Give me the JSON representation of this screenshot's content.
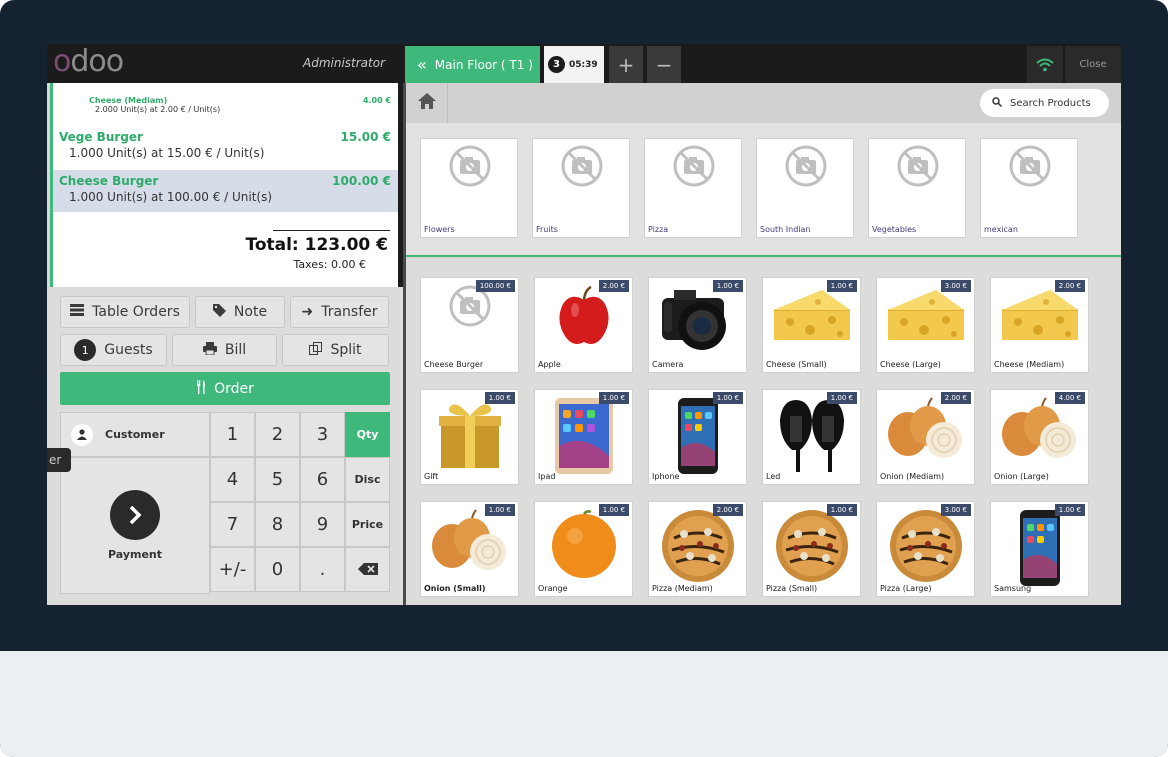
{
  "topbar": {
    "logo_left": "o",
    "logo_right": "doo",
    "user": "Administrator",
    "floor_tab": "Main Floor ( T1 )",
    "order_number": "3",
    "order_time": "05:39",
    "add_label": "+",
    "remove_label": "−",
    "close_label": "Close"
  },
  "order": {
    "lines": [
      {
        "name": "Cheese (Mediam)",
        "price": "4.00 €",
        "info": "2.000 Unit(s) at 2.00 € / Unit(s)"
      },
      {
        "name": "Vege Burger",
        "price": "15.00 €",
        "info": "1.000 Unit(s) at 15.00 € / Unit(s)"
      },
      {
        "name": "Cheese Burger",
        "price": "100.00 €",
        "info": "1.000 Unit(s) at 100.00 € / Unit(s)"
      }
    ],
    "total": "Total: 123.00 €",
    "taxes": "Taxes: 0.00 €"
  },
  "actions": {
    "table_orders": "Table Orders",
    "note": "Note",
    "transfer": "Transfer",
    "guests_count": "1",
    "guests": "Guests",
    "bill": "Bill",
    "split": "Split",
    "order": "Order"
  },
  "keypad": {
    "customer": "Customer",
    "payment": "Payment",
    "keys": [
      "1",
      "2",
      "3",
      "4",
      "5",
      "6",
      "7",
      "8",
      "9",
      "+/-",
      "0",
      "."
    ],
    "modes": [
      "Qty",
      "Disc",
      "Price"
    ],
    "side_tab": "er"
  },
  "search": {
    "placeholder": "Search Products"
  },
  "categories": [
    "Flowers",
    "Fruits",
    "Pizza",
    "South Indian",
    "Vegetables",
    "mexican"
  ],
  "products": [
    {
      "name": "Cheese Burger",
      "price": "100.00 €",
      "icon": "no-image-icon"
    },
    {
      "name": "Apple",
      "price": "2.00 €",
      "icon": "apple-icon"
    },
    {
      "name": "Camera",
      "price": "1.00 €",
      "icon": "camera-icon"
    },
    {
      "name": "Cheese (Small)",
      "price": "1.00 €",
      "icon": "cheese-icon"
    },
    {
      "name": "Cheese (Large)",
      "price": "3.00 €",
      "icon": "cheese-icon"
    },
    {
      "name": "Cheese (Mediam)",
      "price": "2.00 €",
      "icon": "cheese-icon"
    },
    {
      "name": "Gift",
      "price": "1.00 €",
      "icon": "gift-icon"
    },
    {
      "name": "Ipad",
      "price": "1.00 €",
      "icon": "tablet-icon"
    },
    {
      "name": "Iphone",
      "price": "1.00 €",
      "icon": "phone-icon"
    },
    {
      "name": "Led",
      "price": "1.00 €",
      "icon": "led-lamp-icon"
    },
    {
      "name": "Onion (Mediam)",
      "price": "2.00 €",
      "icon": "onion-icon"
    },
    {
      "name": "Onion (Large)",
      "price": "4.00 €",
      "icon": "onion-icon"
    },
    {
      "name": "Onion (Small)",
      "price": "1.00 €",
      "icon": "onion-icon"
    },
    {
      "name": "Orange",
      "price": "1.00 €",
      "icon": "orange-icon"
    },
    {
      "name": "Pizza (Mediam)",
      "price": "2.00 €",
      "icon": "pizza-icon"
    },
    {
      "name": "Pizza (Small)",
      "price": "1.00 €",
      "icon": "pizza-icon"
    },
    {
      "name": "Pizza (Large)",
      "price": "3.00 €",
      "icon": "pizza-icon"
    },
    {
      "name": "Samsung",
      "price": "1.00 €",
      "icon": "phone-icon"
    }
  ],
  "colors": {
    "accent": "#3fb87c",
    "dark": "#1b1b1b",
    "price_badge": "#3c4a6a",
    "frame": "#152232"
  }
}
